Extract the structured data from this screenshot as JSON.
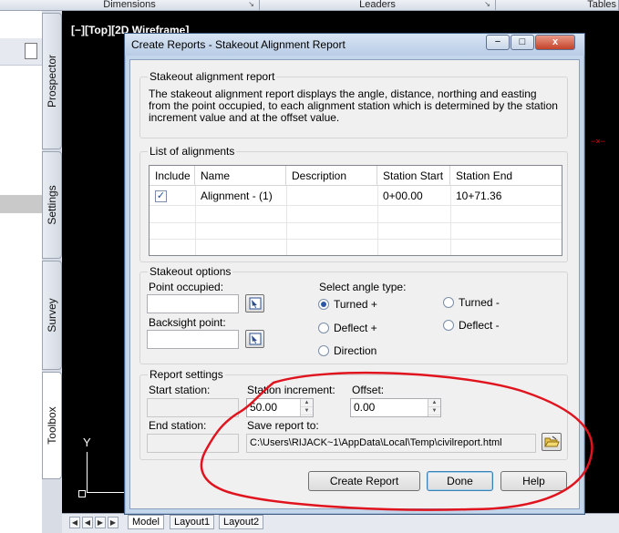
{
  "ribbon": {
    "segments": [
      "Dimensions",
      "Leaders",
      "Tables"
    ]
  },
  "palette": {
    "tabs": [
      "Prospector",
      "Settings",
      "Survey",
      "Toolbox"
    ]
  },
  "viewport": {
    "label": "[−][Top][2D Wireframe]",
    "ucs_y": "Y"
  },
  "layouts": {
    "tabs": [
      "Model",
      "Layout1",
      "Layout2"
    ]
  },
  "dialog": {
    "title": "Create Reports - Stakeout Alignment Report",
    "window_buttons": {
      "minimize": "−",
      "maximize": "□",
      "close": "x"
    },
    "report_group": {
      "label": "Stakeout alignment report",
      "description": "The stakeout alignment report displays the angle, distance, northing and easting from the point occupied, to each alignment station which is determined by the station increment value and at the offset value."
    },
    "alignments_group": {
      "label": "List of alignments",
      "columns": [
        "Include",
        "Name",
        "Description",
        "Station Start",
        "Station End"
      ],
      "rows": [
        {
          "include": true,
          "name": "Alignment - (1)",
          "description": "",
          "station_start": "0+00.00",
          "station_end": "10+71.36"
        }
      ]
    },
    "stakeout_group": {
      "label": "Stakeout options",
      "point_occupied_label": "Point occupied:",
      "point_occupied_value": "",
      "backsight_label": "Backsight point:",
      "backsight_value": "",
      "angle_type_label": "Select angle type:",
      "angle_types": [
        {
          "label": "Turned +",
          "selected": true
        },
        {
          "label": "Turned -",
          "selected": false
        },
        {
          "label": "Deflect +",
          "selected": false
        },
        {
          "label": "Deflect -",
          "selected": false
        },
        {
          "label": "Direction",
          "selected": false
        }
      ]
    },
    "settings_group": {
      "label": "Report settings",
      "start_station_label": "Start station:",
      "end_station_label": "End station:",
      "station_increment_label": "Station increment:",
      "station_increment_value": "50.00",
      "offset_label": "Offset:",
      "offset_value": "0.00",
      "save_report_label": "Save report to:",
      "save_report_path": "C:\\Users\\RIJACK~1\\AppData\\Local\\Temp\\civilreport.html"
    },
    "buttons": {
      "create_report": "Create Report",
      "done": "Done",
      "help": "Help"
    }
  },
  "colors": {
    "annotation": "#e0141e",
    "title_bar": "#c4d6ec",
    "drawing_bg": "#000000"
  }
}
